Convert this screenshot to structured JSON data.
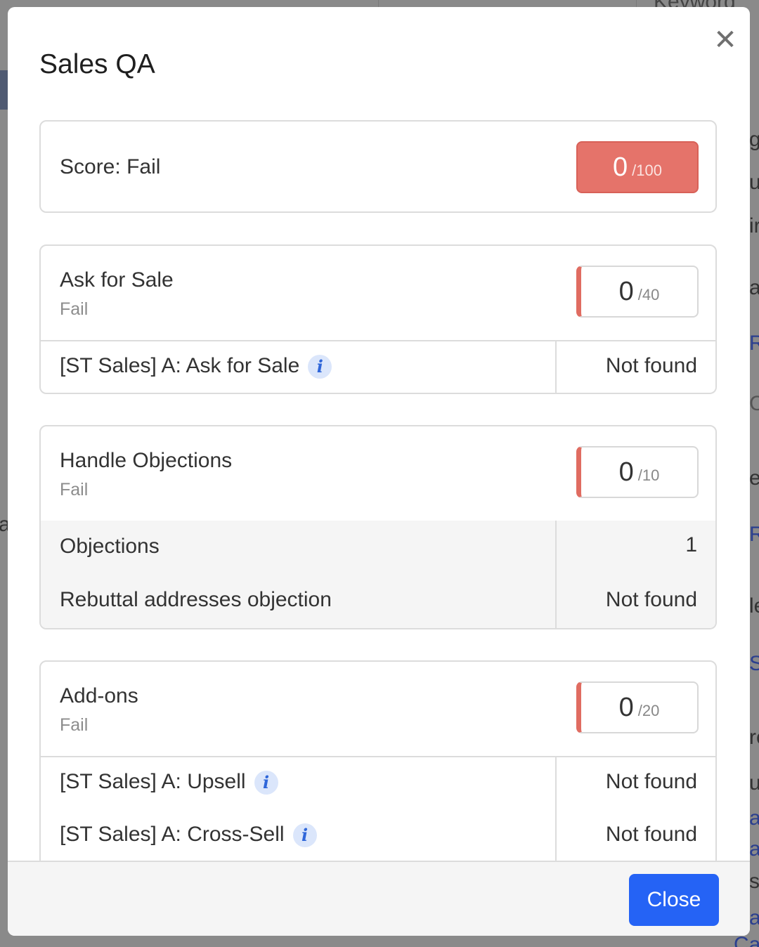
{
  "background": {
    "top_fragment": "Keyword",
    "right_fragments": [
      "g",
      "u",
      "ir",
      "a",
      "R",
      "C",
      "e",
      "R",
      "le",
      "S",
      "re",
      "u",
      "a",
      "a",
      "s",
      "a",
      "Ca"
    ],
    "left_fragment": "a"
  },
  "modal": {
    "title": "Sales QA",
    "close_icon": "close-icon"
  },
  "overall": {
    "label": "Score:",
    "status": "Fail",
    "score": "0",
    "max": "/100",
    "color": "#e5736a"
  },
  "sections": [
    {
      "title": "Ask for Sale",
      "status": "Fail",
      "score": "0",
      "max": "/40",
      "items": [
        {
          "label": "[ST Sales] A: Ask for Sale",
          "value": "Not found",
          "has_info": true
        }
      ]
    },
    {
      "title": "Handle Objections",
      "status": "Fail",
      "score": "0",
      "max": "/10",
      "items": [
        {
          "label": "Objections",
          "value": "1",
          "has_info": false
        },
        {
          "label": "Rebuttal addresses objection",
          "value": "Not found",
          "has_info": false
        }
      ]
    },
    {
      "title": "Add-ons",
      "status": "Fail",
      "score": "0",
      "max": "/20",
      "items": [
        {
          "label": "[ST Sales] A: Upsell",
          "value": "Not found",
          "has_info": true
        },
        {
          "label": "[ST Sales] A: Cross-Sell",
          "value": "Not found",
          "has_info": true
        }
      ]
    }
  ],
  "footer": {
    "close_label": "Close",
    "accent_color": "#2563f5"
  }
}
